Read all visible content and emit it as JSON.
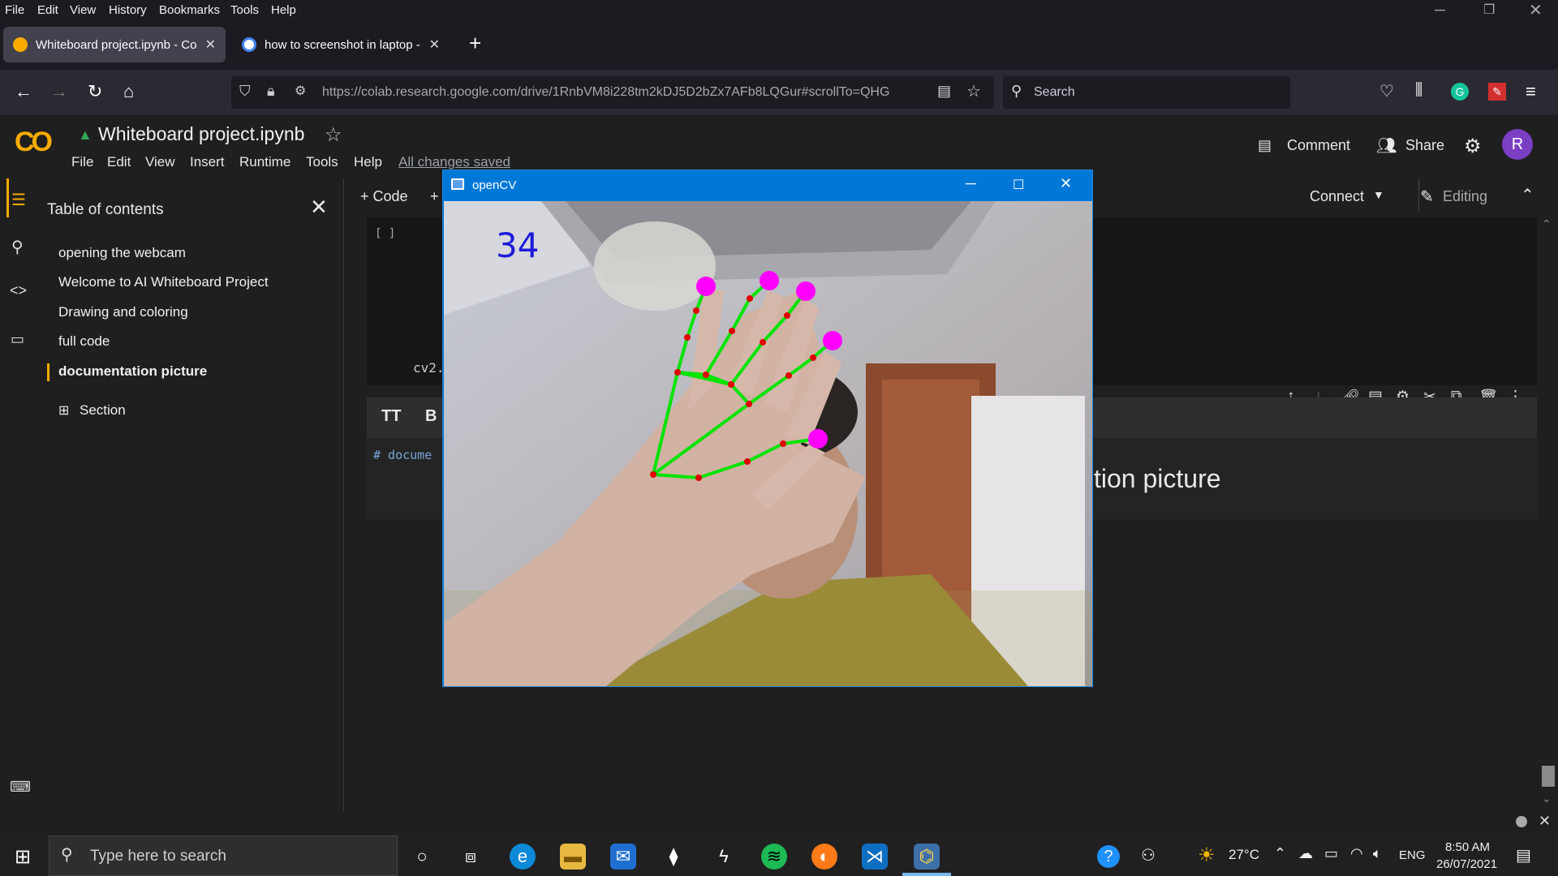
{
  "menubar": [
    "File",
    "Edit",
    "View",
    "History",
    "Bookmarks",
    "Tools",
    "Help"
  ],
  "tabs": [
    {
      "title": "Whiteboard project.ipynb - Col",
      "active": true
    },
    {
      "title": "how to screenshot in laptop - P",
      "active": false
    }
  ],
  "url": "https://colab.research.google.com/drive/1RnbVM8i228tm2kDJ5D2bZx7AFb8LQGur#scrollTo=QHG",
  "search_placeholder": "Search",
  "colab": {
    "logo": "CO",
    "title": "Whiteboard project.ipynb",
    "menu": [
      "File",
      "Edit",
      "View",
      "Insert",
      "Runtime",
      "Tools",
      "Help"
    ],
    "saved": "All changes saved",
    "comment": "Comment",
    "share": "Share",
    "avatar": "R",
    "connect": "Connect",
    "editing": "Editing",
    "add_code": "+ Code",
    "add_text": "+"
  },
  "toc": {
    "header": "Table of contents",
    "items": [
      "opening the webcam",
      "Welcome to AI Whiteboard Project",
      "Drawing and coloring",
      "full code",
      "documentation picture"
    ],
    "add_section": "Section"
  },
  "cells": {
    "code_brackets": "[ ]",
    "code_snippet": "cv2.",
    "text_snippet": "# docume",
    "heading_visible": "tion picture"
  },
  "opencv_window": {
    "title": "openCV",
    "fps": "34"
  },
  "taskbar": {
    "search_placeholder": "Type here to search",
    "temperature": "27°C",
    "language": "ENG",
    "time": "8:50 AM",
    "date": "26/07/2021"
  },
  "colors": {
    "accent": "#f9ab00",
    "cv_titlebar": "#0078d7",
    "landmark": "#ff00ff",
    "bone": "#00ff00"
  }
}
